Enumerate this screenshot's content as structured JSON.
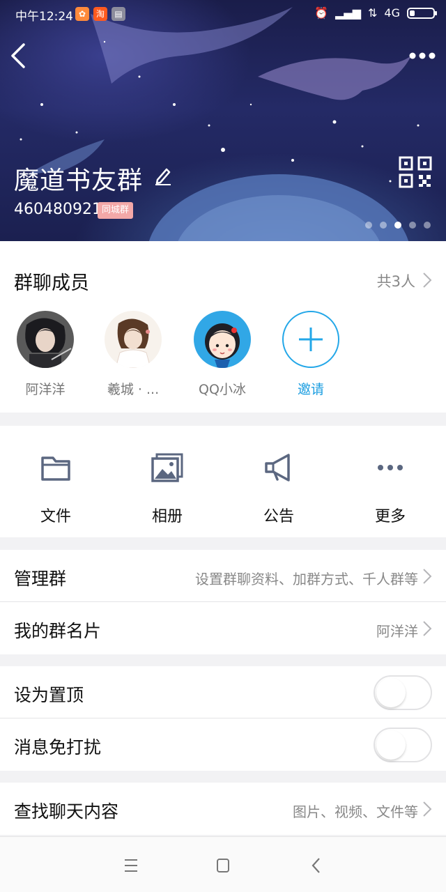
{
  "status_bar": {
    "time": "中午12:24",
    "network": "4G",
    "battery_level": 0.22,
    "apps": [
      {
        "icon": "taobao-store-icon",
        "glyph": "✿",
        "color": "#ff8a3c"
      },
      {
        "icon": "taobao-icon",
        "glyph": "淘",
        "color": "#ff5a1f"
      },
      {
        "icon": "calculator-icon",
        "glyph": "▤",
        "color": "#8c8c9c"
      }
    ]
  },
  "header": {
    "group_name": "魔道书友群",
    "group_id": "460480921",
    "group_tag": "同城群",
    "carousel_dots": 5,
    "carousel_active": 3
  },
  "members": {
    "title": "群聊成员",
    "count_label": "共3人",
    "list": [
      {
        "name": "阿洋洋"
      },
      {
        "name": "羲城 · ..."
      },
      {
        "name": "QQ小冰"
      }
    ],
    "invite_label": "邀请"
  },
  "actions": [
    {
      "label": "文件",
      "icon": "folder-icon"
    },
    {
      "label": "相册",
      "icon": "photo-album-icon"
    },
    {
      "label": "公告",
      "icon": "megaphone-icon"
    },
    {
      "label": "更多",
      "icon": "more-dots-icon"
    }
  ],
  "settings": {
    "manage_group": {
      "label": "管理群",
      "value": "设置群聊资料、加群方式、千人群等"
    },
    "my_card": {
      "label": "我的群名片",
      "value": "阿洋洋"
    },
    "pin_top": {
      "label": "设为置顶",
      "on": false
    },
    "mute": {
      "label": "消息免打扰",
      "on": false
    },
    "search_chat": {
      "label": "查找聊天内容",
      "value": "图片、视频、文件等"
    }
  },
  "colors": {
    "accent": "#23a7e8",
    "tag_bg": "#f3a8a8"
  }
}
